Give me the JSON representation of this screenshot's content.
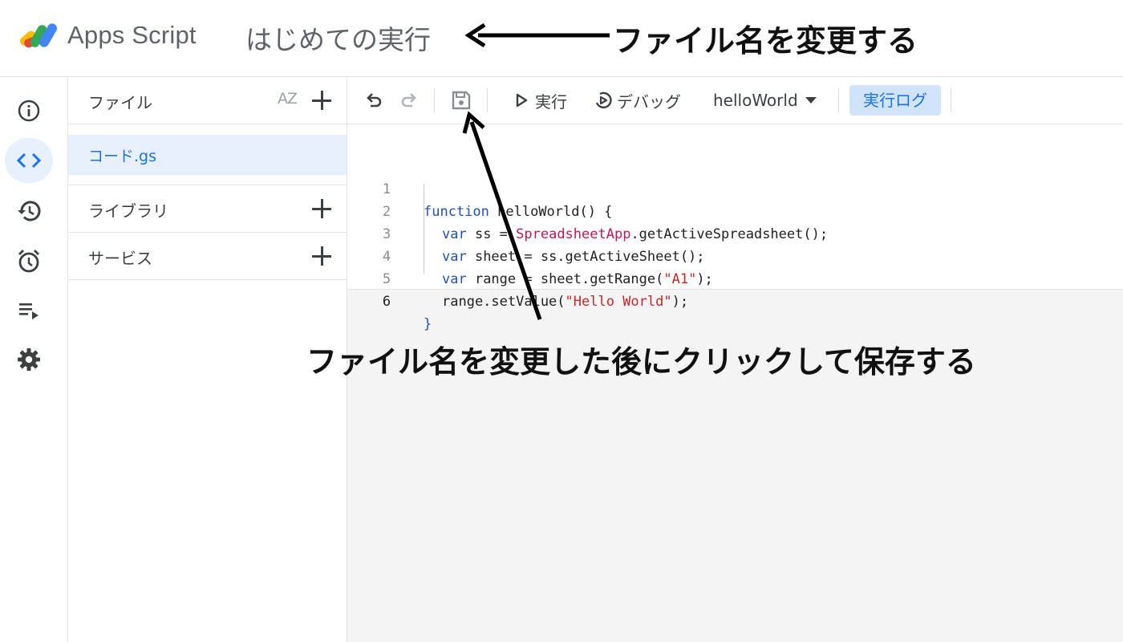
{
  "header": {
    "app_name": "Apps Script",
    "project_title": "はじめての実行"
  },
  "annotations": {
    "rename": "ファイル名を変更する",
    "save": "ファイル名を変更した後にクリックして保存する"
  },
  "rail": {
    "items": [
      {
        "icon": "info-icon"
      },
      {
        "icon": "code-icon",
        "active": true
      },
      {
        "icon": "history-icon"
      },
      {
        "icon": "alarm-icon"
      },
      {
        "icon": "executions-icon"
      },
      {
        "icon": "gear-icon"
      }
    ]
  },
  "files_panel": {
    "files_label": "ファイル",
    "sort_label": "AZ",
    "files": [
      {
        "name": "コード.gs",
        "selected": true
      }
    ],
    "libraries_label": "ライブラリ",
    "services_label": "サービス"
  },
  "toolbar": {
    "run_label": "実行",
    "debug_label": "デバッグ",
    "function_name": "helloWorld",
    "log_label": "実行ログ"
  },
  "code": {
    "line_numbers": [
      "1",
      "2",
      "3",
      "4",
      "5",
      "6"
    ],
    "l1_kw": "function",
    "l1_rest": " helloWorld() {",
    "l2_kw": "var",
    "l2_a": " ss = ",
    "l2_cls": "SpreadsheetApp",
    "l2_b": ".getActiveSpreadsheet();",
    "l3_kw": "var",
    "l3_a": " sheet = ss.getActiveSheet();",
    "l4_kw": "var",
    "l4_a": " range = sheet.getRange(",
    "l4_str": "\"A1\"",
    "l4_b": ");",
    "l5_a": "range.setValue(",
    "l5_str": "\"Hello World\"",
    "l5_b": ");",
    "l6": "}"
  },
  "colors": {
    "accent": "#1a73e8",
    "active_bg": "#e8f0fe",
    "log_bg": "#d2e3fc",
    "keyword": "#2251b5",
    "class": "#c2185b",
    "string": "#c62828"
  }
}
